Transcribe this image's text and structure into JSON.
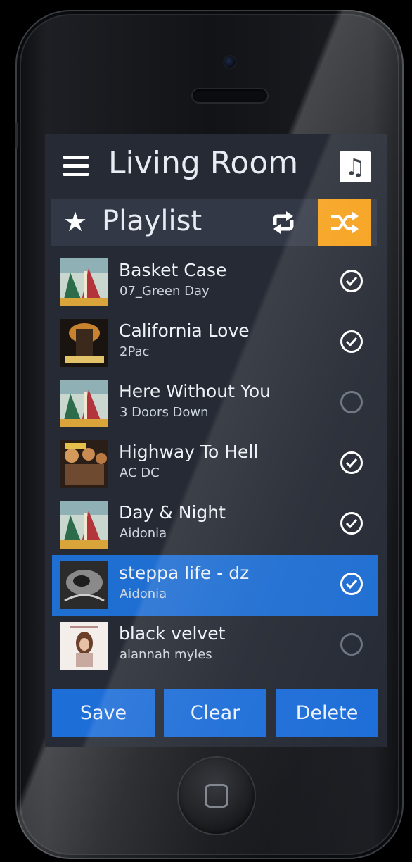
{
  "header": {
    "title": "Living Room",
    "menu_icon": "hamburger-menu-icon",
    "music_icon": "music-note-icon"
  },
  "playlist_bar": {
    "label": "Playlist",
    "star_icon": "star-icon",
    "repeat_icon": "repeat-icon",
    "shuffle_icon": "shuffle-icon",
    "shuffle_active_color": "#f6a11a"
  },
  "songs": [
    {
      "title": "Basket Case",
      "artist": "07_Green Day",
      "checked": true,
      "selected": false
    },
    {
      "title": "California Love",
      "artist": "2Pac",
      "checked": true,
      "selected": false
    },
    {
      "title": "Here Without You",
      "artist": "3 Doors Down",
      "checked": false,
      "selected": false
    },
    {
      "title": "Highway To Hell",
      "artist": "AC DC",
      "checked": true,
      "selected": false
    },
    {
      "title": "Day & Night",
      "artist": "Aidonia",
      "checked": true,
      "selected": false
    },
    {
      "title": "steppa life - dz",
      "artist": "Aidonia",
      "checked": true,
      "selected": true
    },
    {
      "title": "black velvet",
      "artist": "alannah myles",
      "checked": false,
      "selected": false
    }
  ],
  "actions": {
    "save": "Save",
    "clear": "Clear",
    "delete": "Delete"
  },
  "colors": {
    "accent_blue": "#1e6ed8",
    "accent_orange": "#f6a11a",
    "screen_bg": "#252a34"
  }
}
